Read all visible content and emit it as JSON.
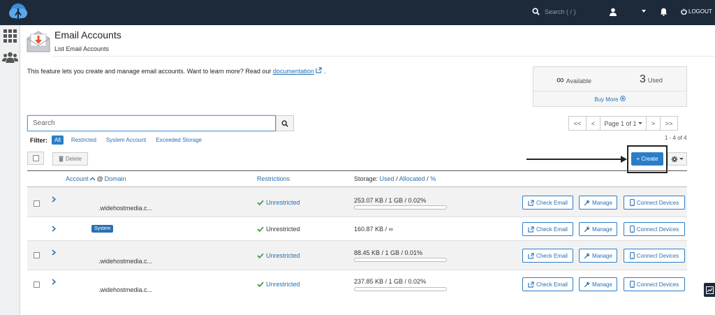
{
  "topbar": {
    "search_placeholder": "Search ( / )",
    "logout_label": "LOGOUT",
    "icons": {
      "logo": "cloud-logo-icon",
      "search": "search-icon",
      "user": "user-icon",
      "bell": "bell-icon",
      "logout": "power-icon"
    }
  },
  "leftbar": {
    "icons": [
      "grid-icon",
      "users-icon"
    ]
  },
  "page": {
    "title": "Email Accounts",
    "subtitle": "List Email Accounts",
    "intro_text": "This feature lets you create and manage email accounts. Want to learn more? Read our",
    "intro_link": "documentation",
    "intro_end": "."
  },
  "stats": {
    "available_value": "∞",
    "available_label": "Available",
    "used_value": "3",
    "used_label": "Used",
    "buy_more": "Buy More"
  },
  "search": {
    "placeholder": "Search"
  },
  "pager": {
    "first": "<<",
    "prev": "<",
    "page": "Page 1 of 1",
    "next": ">",
    "last": ">>",
    "count": "1 - 4 of 4"
  },
  "filter": {
    "label": "Filter:",
    "options": [
      "All",
      "Restricted",
      "System Account",
      "Exceeded Storage"
    ],
    "selected": "All"
  },
  "toolbar": {
    "delete_label": "Delete",
    "create_label": "+ Create"
  },
  "table": {
    "headers": {
      "account": "Account",
      "at_domain": "@",
      "domain": "Domain",
      "restrictions": "Restrictions",
      "storage": "Storage:",
      "used": "Used",
      "sep1": "/",
      "allocated": "Allocated",
      "sep2": "/",
      "percent": "%"
    },
    "rows": [
      {
        "domain": ".widehostmedia.c...",
        "badge": "",
        "restriction": "Unrestricted",
        "storage": "253.07 KB / 1 GB / 0.02%",
        "usage_fraction": 0.0002,
        "shaded": true,
        "checkbox": true
      },
      {
        "domain": "",
        "badge": "System",
        "restriction": "Unrestricted",
        "storage": "160.87 KB / ∞",
        "usage_fraction": null,
        "shaded": false,
        "checkbox": false
      },
      {
        "domain": ".widehostmedia.c...",
        "badge": "",
        "restriction": "Unrestricted",
        "storage": "88.45 KB / 1 GB / 0.01%",
        "usage_fraction": 0.0001,
        "shaded": true,
        "checkbox": true
      },
      {
        "domain": ".widehostmedia.c...",
        "badge": "",
        "restriction": "Unrestricted",
        "storage": "237.85 KB / 1 GB / 0.02%",
        "usage_fraction": 0.0002,
        "shaded": false,
        "checkbox": true
      }
    ],
    "actions": {
      "check_email": "Check Email",
      "manage": "Manage",
      "connect_devices": "Connect Devices"
    }
  },
  "colors": {
    "topbar": "#1d2a3a",
    "accent": "#2a7ec8",
    "link": "#2a6fb0",
    "success": "#3c9a3c"
  }
}
